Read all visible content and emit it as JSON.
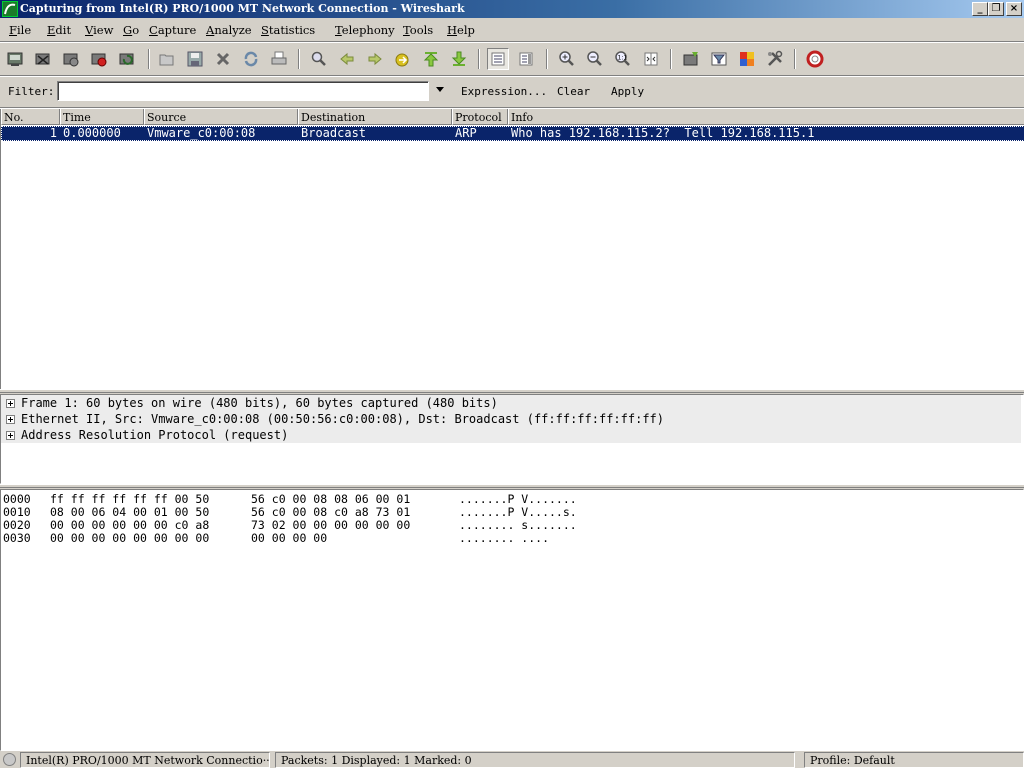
{
  "window": {
    "title": "Capturing from Intel(R) PRO/1000 MT Network Connection - Wireshark",
    "minimize": "_",
    "restore": "❐",
    "close": "×"
  },
  "menu": [
    "File",
    "Edit",
    "View",
    "Go",
    "Capture",
    "Analyze",
    "Statistics",
    "Telephony",
    "Tools",
    "Help"
  ],
  "toolbar_icons": [
    "interface-list-icon",
    "capture-options-icon",
    "start-capture-icon",
    "stop-capture-icon",
    "restart-capture-icon",
    "open-file-icon",
    "save-file-icon",
    "close-file-icon",
    "reload-icon",
    "print-icon",
    "find-packet-icon",
    "go-back-icon",
    "go-forward-icon",
    "go-to-packet-icon",
    "go-first-icon",
    "go-last-icon",
    "colorize-icon",
    "auto-scroll-icon",
    "zoom-in-icon",
    "zoom-out-icon",
    "normal-size-icon",
    "resize-columns-icon",
    "capture-filters-icon",
    "display-filters-icon",
    "coloring-rules-icon",
    "preferences-icon",
    "help-icon"
  ],
  "filter": {
    "label": "Filter:",
    "value": "",
    "expression": "Expression...",
    "clear": "Clear",
    "apply": "Apply"
  },
  "packet_list": {
    "columns": [
      "No.",
      "Time",
      "Source",
      "Destination",
      "Protocol",
      "Info"
    ],
    "rows": [
      {
        "no": "1",
        "time": "0.000000",
        "source": "Vmware_c0:00:08",
        "destination": "Broadcast",
        "protocol": "ARP",
        "info": "Who has 192.168.115.2?  Tell 192.168.115.1"
      }
    ]
  },
  "details": [
    "Frame 1: 60 bytes on wire (480 bits), 60 bytes captured (480 bits)",
    "Ethernet II, Src: Vmware_c0:00:08 (00:50:56:c0:00:08), Dst: Broadcast (ff:ff:ff:ff:ff:ff)",
    "Address Resolution Protocol (request)"
  ],
  "bytes": [
    {
      "offset": "0000",
      "hex1": "ff ff ff ff ff ff 00 50",
      "hex2": "56 c0 00 08 08 06 00 01",
      "ascii": ".......P V......."
    },
    {
      "offset": "0010",
      "hex1": "08 00 06 04 00 01 00 50",
      "hex2": "56 c0 00 08 c0 a8 73 01",
      "ascii": ".......P V.....s."
    },
    {
      "offset": "0020",
      "hex1": "00 00 00 00 00 00 c0 a8",
      "hex2": "73 02 00 00 00 00 00 00",
      "ascii": "........ s......."
    },
    {
      "offset": "0030",
      "hex1": "00 00 00 00 00 00 00 00",
      "hex2": "00 00 00 00",
      "ascii": "........ ...."
    }
  ],
  "status": {
    "interface": "Intel(R) PRO/1000 MT Network Connectio···",
    "packets": "Packets: 1 Displayed: 1 Marked: 0",
    "profile": "Profile: Default"
  }
}
